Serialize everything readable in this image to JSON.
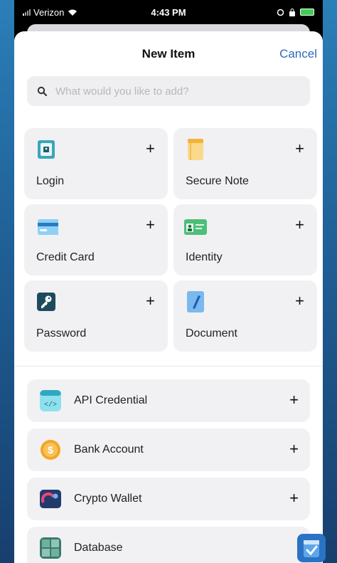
{
  "statusbar": {
    "carrier": "Verizon",
    "time": "4:43 PM"
  },
  "header": {
    "title": "New Item",
    "cancel_label": "Cancel"
  },
  "search": {
    "placeholder": "What would you like to add?"
  },
  "tiles": [
    {
      "label": "Login",
      "icon": "login-icon",
      "color": "#3aa7b9"
    },
    {
      "label": "Secure Note",
      "icon": "note-icon",
      "color": "#f5b23a"
    },
    {
      "label": "Credit Card",
      "icon": "credit-card-icon",
      "color": "#4aa8e8"
    },
    {
      "label": "Identity",
      "icon": "identity-icon",
      "color": "#4cbf78"
    },
    {
      "label": "Password",
      "icon": "key-icon",
      "color": "#1c4b5e"
    },
    {
      "label": "Document",
      "icon": "document-icon",
      "color": "#5aa7e8"
    }
  ],
  "list_items": [
    {
      "label": "API Credential",
      "icon": "api-icon",
      "color": "#5ec8dc"
    },
    {
      "label": "Bank Account",
      "icon": "bank-icon",
      "color": "#f5a623"
    },
    {
      "label": "Crypto Wallet",
      "icon": "wallet-icon",
      "color": "#243a6b"
    },
    {
      "label": "Database",
      "icon": "database-icon",
      "color": "#3a7a6a"
    }
  ],
  "plus_symbol": "+"
}
